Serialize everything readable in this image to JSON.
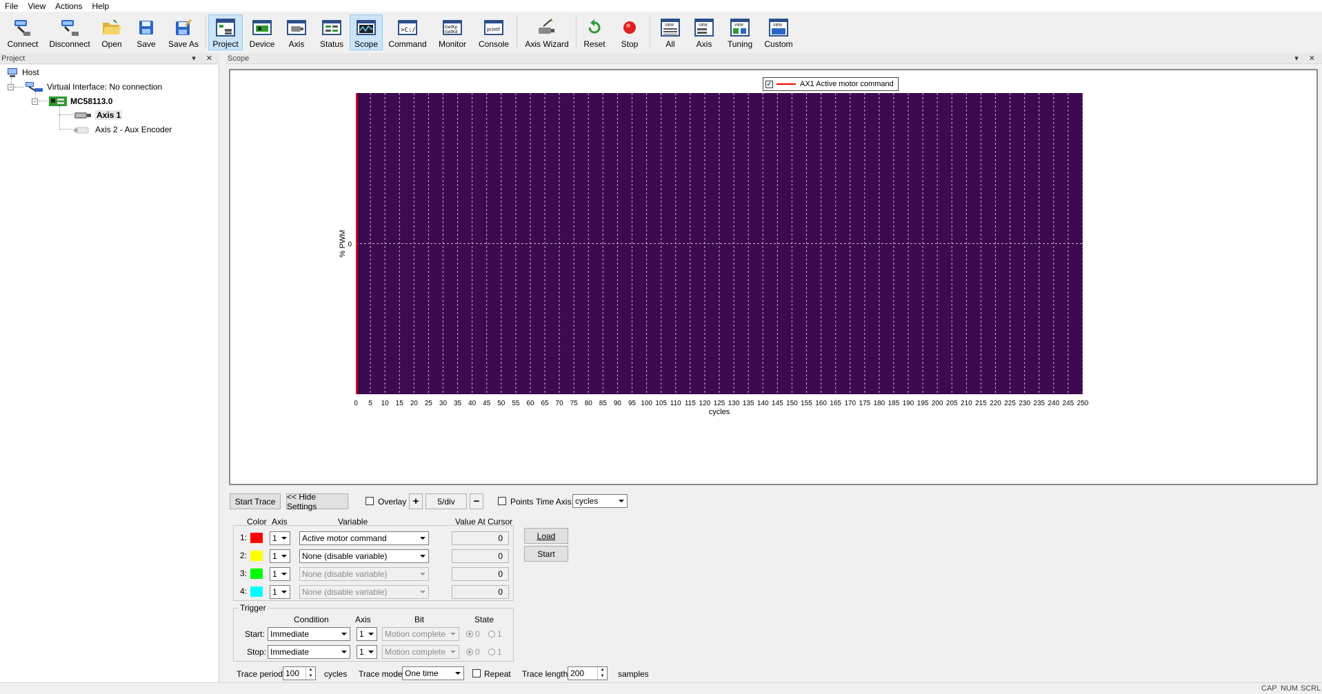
{
  "menu": [
    "File",
    "View",
    "Actions",
    "Help"
  ],
  "toolbar": {
    "buttons": [
      {
        "label": "Connect",
        "icon": "connect-icon"
      },
      {
        "label": "Disconnect",
        "icon": "disconnect-icon"
      },
      {
        "label": "Open",
        "icon": "folder-open-icon"
      },
      {
        "label": "Save",
        "icon": "save-icon"
      },
      {
        "label": "Save As",
        "icon": "save-as-icon"
      },
      {
        "label": "Project",
        "icon": "project-icon",
        "active": true
      },
      {
        "label": "Device",
        "icon": "device-icon"
      },
      {
        "label": "Axis",
        "icon": "axis-icon"
      },
      {
        "label": "Status",
        "icon": "status-icon"
      },
      {
        "label": "Scope",
        "icon": "scope-icon",
        "active": true
      },
      {
        "label": "Command",
        "icon": "command-icon"
      },
      {
        "label": "Monitor",
        "icon": "monitor-icon"
      },
      {
        "label": "Console",
        "icon": "console-icon"
      },
      {
        "label": "Axis Wizard",
        "icon": "axis-wizard-icon"
      },
      {
        "label": "Reset",
        "icon": "reset-icon"
      },
      {
        "label": "Stop",
        "icon": "stop-icon"
      },
      {
        "label": "All",
        "icon": "view-all-icon"
      },
      {
        "label": "Axis",
        "icon": "view-axis-icon"
      },
      {
        "label": "Tuning",
        "icon": "view-tuning-icon"
      },
      {
        "label": "Custom",
        "icon": "view-custom-icon"
      }
    ]
  },
  "project_panel": {
    "title": "Project",
    "tree": {
      "host": "Host",
      "interface": "Virtual Interface: No connection",
      "controller": "MC58113.0",
      "axis1": "Axis 1",
      "axis2": "Axis 2 - Aux Encoder"
    }
  },
  "scope_panel": {
    "title": "Scope"
  },
  "chart_data": {
    "type": "line",
    "legend": [
      "AX1 Active motor command"
    ],
    "legend_placement": "top-center",
    "xlabel": "cycles",
    "ylabel": "% PWM",
    "xlim": [
      0,
      250
    ],
    "x_ticks": [
      0,
      5,
      10,
      15,
      20,
      25,
      30,
      35,
      40,
      45,
      50,
      55,
      60,
      65,
      70,
      75,
      80,
      85,
      90,
      95,
      100,
      105,
      110,
      115,
      120,
      125,
      130,
      135,
      140,
      145,
      150,
      155,
      160,
      165,
      170,
      175,
      180,
      185,
      190,
      195,
      200,
      205,
      210,
      215,
      220,
      225,
      230,
      235,
      240,
      245,
      250
    ],
    "y_ticks": [
      0
    ],
    "grid": true,
    "background": "#3d0a4f",
    "series": [
      {
        "name": "AX1 Active motor command",
        "color": "#ff0000",
        "x": [
          0,
          0
        ],
        "y": [
          0,
          0
        ]
      }
    ]
  },
  "settings": {
    "start_trace": "Start Trace",
    "hide_settings": "<< Hide Settings",
    "overlay": "Overlay",
    "plus": "+",
    "div": "5/div",
    "minus": "−",
    "points": "Points",
    "time_axis_label": "Time Axis:",
    "time_axis_value": "cycles",
    "headers": {
      "color": "Color",
      "axis": "Axis",
      "variable": "Variable",
      "value": "Value At Cursor"
    },
    "rows": [
      {
        "num": "1:",
        "color": "#ff0000",
        "axis": "1",
        "variable": "Active motor command",
        "value": "0",
        "enabled": true
      },
      {
        "num": "2:",
        "color": "#ffff00",
        "axis": "1",
        "variable": "None (disable variable)",
        "value": "0",
        "enabled": true
      },
      {
        "num": "3:",
        "color": "#00ff00",
        "axis": "1",
        "variable": "None (disable variable)",
        "value": "0",
        "enabled": false
      },
      {
        "num": "4:",
        "color": "#00ffff",
        "axis": "1",
        "variable": "None (disable variable)",
        "value": "0",
        "enabled": false
      }
    ],
    "load": "Load",
    "start": "Start",
    "trigger": {
      "title": "Trigger",
      "headers": {
        "condition": "Condition",
        "axis": "Axis",
        "bit": "Bit",
        "state": "State"
      },
      "start_label": "Start:",
      "stop_label": "Stop:",
      "start_condition": "Immediate",
      "stop_condition": "Immediate",
      "start_axis": "1",
      "stop_axis": "1",
      "start_bit": "Motion complete",
      "stop_bit": "Motion complete",
      "state0": "0",
      "state1": "1"
    },
    "trace_period_label": "Trace period:",
    "trace_period_value": "100",
    "trace_period_unit": "cycles",
    "trace_mode_label": "Trace mode:",
    "trace_mode_value": "One time",
    "repeat": "Repeat",
    "trace_length_label": "Trace length:",
    "trace_length_value": "200",
    "trace_length_unit": "samples"
  },
  "statusbar": {
    "cap": "CAP",
    "num": "NUM",
    "scrl": "SCRL"
  }
}
